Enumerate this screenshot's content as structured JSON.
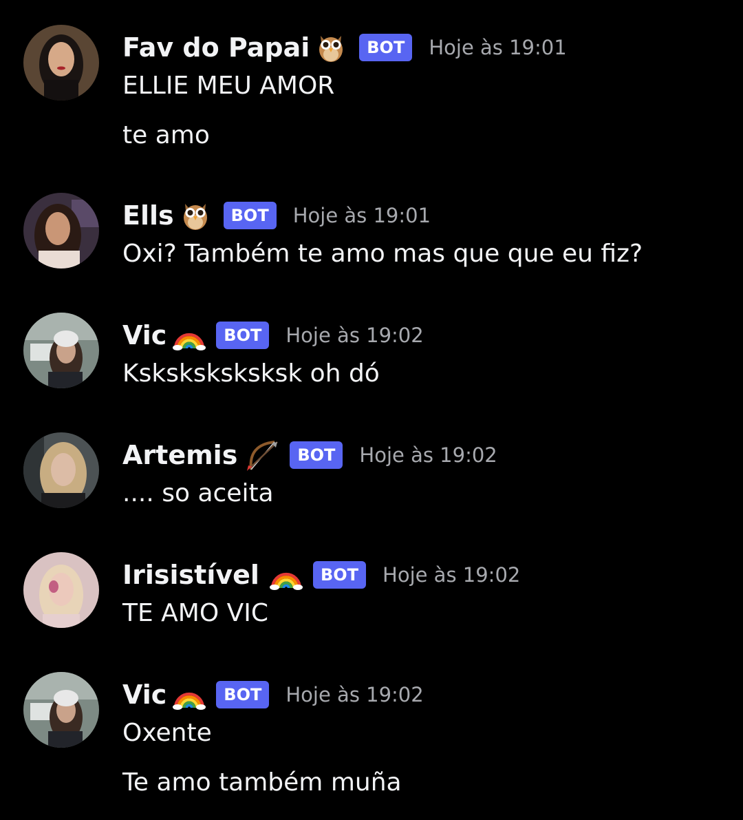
{
  "messages": [
    {
      "author": "Fav do Papai",
      "author_emoji": "owl-emoji",
      "badge": "BOT",
      "timestamp": "Hoje às 19:01",
      "lines": [
        "ELLIE MEU AMOR",
        "te amo"
      ]
    },
    {
      "author": "Ells",
      "author_emoji": "owl-emoji",
      "badge": "BOT",
      "timestamp": "Hoje às 19:01",
      "lines": [
        "Oxi? Também te amo mas que que eu fiz?"
      ]
    },
    {
      "author": "Vic",
      "author_emoji": "rainbow-emoji",
      "badge": "BOT",
      "timestamp": "Hoje às 19:02",
      "lines": [
        "Ksksksksksksk oh dó"
      ]
    },
    {
      "author": "Artemis",
      "author_emoji": "bow-and-arrow-emoji",
      "badge": "BOT",
      "timestamp": "Hoje às 19:02",
      "lines": [
        ".... so aceita"
      ]
    },
    {
      "author": "Irisistível",
      "author_emoji": "rainbow-emoji",
      "badge": "BOT",
      "timestamp": "Hoje às 19:02",
      "lines": [
        "TE AMO VIC"
      ]
    },
    {
      "author": "Vic",
      "author_emoji": "rainbow-emoji",
      "badge": "BOT",
      "timestamp": "Hoje às 19:02",
      "lines": [
        "Oxente",
        "Te amo também muña"
      ]
    }
  ],
  "colors": {
    "background": "#000000",
    "text": "#f2f3f5",
    "timestamp": "#a7a9ae",
    "bot_badge": "#5865f2"
  }
}
